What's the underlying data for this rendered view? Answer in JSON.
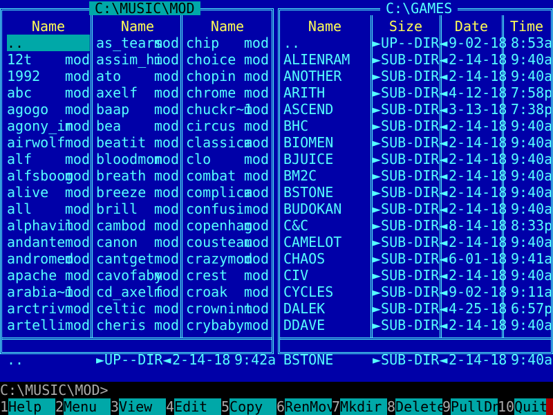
{
  "left_panel": {
    "title": "C:\\MUSIC\\MOD",
    "column_header": "Name",
    "columns": [
      [
        {
          "name": "..",
          "ext": ""
        },
        {
          "name": "12t",
          "ext": "mod"
        },
        {
          "name": "1992",
          "ext": "mod"
        },
        {
          "name": "abc",
          "ext": "mod"
        },
        {
          "name": "agogo",
          "ext": "mod"
        },
        {
          "name": "agony_in",
          "ext": "mod"
        },
        {
          "name": "airwolf",
          "ext": "mod"
        },
        {
          "name": "alf",
          "ext": "mod"
        },
        {
          "name": "alfsboog",
          "ext": "mod"
        },
        {
          "name": "alive",
          "ext": "mod"
        },
        {
          "name": "all",
          "ext": "mod"
        },
        {
          "name": "alphavil",
          "ext": "mod"
        },
        {
          "name": "andante",
          "ext": "mod"
        },
        {
          "name": "andromed",
          "ext": "mod"
        },
        {
          "name": "apache",
          "ext": "mod"
        },
        {
          "name": "arabia~1",
          "ext": "mod"
        },
        {
          "name": "arctriv",
          "ext": "mod"
        },
        {
          "name": "artelli",
          "ext": "mod"
        }
      ],
      [
        {
          "name": "as_tears",
          "ext": "mod"
        },
        {
          "name": "assim_hi",
          "ext": "mod"
        },
        {
          "name": "ato",
          "ext": "mod"
        },
        {
          "name": "axelf",
          "ext": "mod"
        },
        {
          "name": "baap",
          "ext": "mod"
        },
        {
          "name": "bea",
          "ext": "mod"
        },
        {
          "name": "beatit",
          "ext": "mod"
        },
        {
          "name": "bloodmon",
          "ext": "mod"
        },
        {
          "name": "breath",
          "ext": "mod"
        },
        {
          "name": "breeze",
          "ext": "mod"
        },
        {
          "name": "brill",
          "ext": "mod"
        },
        {
          "name": "cambod",
          "ext": "mod"
        },
        {
          "name": "canon",
          "ext": "mod"
        },
        {
          "name": "cantget",
          "ext": "mod"
        },
        {
          "name": "cavofaby",
          "ext": "mod"
        },
        {
          "name": "cd_axelf",
          "ext": "mod"
        },
        {
          "name": "celtic",
          "ext": "mod"
        },
        {
          "name": "cheris",
          "ext": "mod"
        }
      ],
      [
        {
          "name": "chip",
          "ext": "mod"
        },
        {
          "name": "choice",
          "ext": "mod"
        },
        {
          "name": "chopin",
          "ext": "mod"
        },
        {
          "name": "chrome",
          "ext": "mod"
        },
        {
          "name": "chuckr~1",
          "ext": "mod"
        },
        {
          "name": "circus",
          "ext": "mod"
        },
        {
          "name": "classica",
          "ext": "mod"
        },
        {
          "name": "clo",
          "ext": "mod"
        },
        {
          "name": "combat",
          "ext": "mod"
        },
        {
          "name": "complica",
          "ext": "mod"
        },
        {
          "name": "confusi",
          "ext": "mod"
        },
        {
          "name": "copenhag",
          "ext": "mod"
        },
        {
          "name": "cousteau",
          "ext": "mod"
        },
        {
          "name": "crazymod",
          "ext": "mod"
        },
        {
          "name": "crest",
          "ext": "mod"
        },
        {
          "name": "croak",
          "ext": "mod"
        },
        {
          "name": "crownint",
          "ext": "mod"
        },
        {
          "name": "crybaby",
          "ext": "mod"
        }
      ]
    ],
    "status": {
      "name": "..",
      "size": "►UP--DIR◄",
      "date": "2-14-18",
      "time": "9:42a"
    }
  },
  "right_panel": {
    "title": "C:\\GAMES",
    "headers": {
      "name": "Name",
      "size": "Size",
      "date": "Date",
      "time": "Time"
    },
    "rows": [
      {
        "name": "..",
        "size": "►UP--DIR◄",
        "date": "9-02-18",
        "time": "8:53a"
      },
      {
        "name": "ALIENRAM",
        "size": "►SUB-DIR◄",
        "date": "2-14-18",
        "time": "9:40a"
      },
      {
        "name": "ANOTHER",
        "size": "►SUB-DIR◄",
        "date": "2-14-18",
        "time": "9:40a"
      },
      {
        "name": "ARITH",
        "size": "►SUB-DIR◄",
        "date": "4-12-18",
        "time": "7:58p"
      },
      {
        "name": "ASCEND",
        "size": "►SUB-DIR◄",
        "date": "3-13-18",
        "time": "7:38p"
      },
      {
        "name": "BHC",
        "size": "►SUB-DIR◄",
        "date": "2-14-18",
        "time": "9:40a"
      },
      {
        "name": "BIOMEN",
        "size": "►SUB-DIR◄",
        "date": "2-14-18",
        "time": "9:40a"
      },
      {
        "name": "BJUICE",
        "size": "►SUB-DIR◄",
        "date": "2-14-18",
        "time": "9:40a"
      },
      {
        "name": "BM2C",
        "size": "►SUB-DIR◄",
        "date": "2-14-18",
        "time": "9:40a"
      },
      {
        "name": "BSTONE",
        "size": "►SUB-DIR◄",
        "date": "2-14-18",
        "time": "9:40a"
      },
      {
        "name": "BUDOKAN",
        "size": "►SUB-DIR◄",
        "date": "2-14-18",
        "time": "9:40a"
      },
      {
        "name": "C&C",
        "size": "►SUB-DIR◄",
        "date": "8-14-18",
        "time": "8:33p"
      },
      {
        "name": "CAMELOT",
        "size": "►SUB-DIR◄",
        "date": "2-14-18",
        "time": "9:40a"
      },
      {
        "name": "CHAOS",
        "size": "►SUB-DIR◄",
        "date": "6-01-18",
        "time": "9:41a"
      },
      {
        "name": "CIV",
        "size": "►SUB-DIR◄",
        "date": "2-14-18",
        "time": "9:40a"
      },
      {
        "name": "CYCLES",
        "size": "►SUB-DIR◄",
        "date": "9-02-18",
        "time": "9:11a"
      },
      {
        "name": "DALEK",
        "size": "►SUB-DIR◄",
        "date": "4-25-18",
        "time": "6:57p"
      },
      {
        "name": "DDAVE",
        "size": "►SUB-DIR◄",
        "date": "2-14-18",
        "time": "9:40a"
      }
    ],
    "status": {
      "name": "BSTONE",
      "size": "►SUB-DIR◄",
      "date": "2-14-18",
      "time": "9:40a"
    }
  },
  "command_line": "C:\\MUSIC\\MOD>",
  "function_keys": [
    {
      "num": "1",
      "label": "Help  "
    },
    {
      "num": "2",
      "label": "Menu  "
    },
    {
      "num": "3",
      "label": "View  "
    },
    {
      "num": "4",
      "label": "Edit  "
    },
    {
      "num": "5",
      "label": "Copy  "
    },
    {
      "num": "6",
      "label": "RenMov"
    },
    {
      "num": "7",
      "label": "Mkdir "
    },
    {
      "num": "8",
      "label": "Delete"
    },
    {
      "num": "9",
      "label": "PullDn"
    },
    {
      "num": "10",
      "label": "Quit "
    }
  ],
  "colors": {
    "background": "#0000a8",
    "frame": "#55ffff",
    "header": "#ffff55",
    "cursor": "#00a8a8"
  }
}
